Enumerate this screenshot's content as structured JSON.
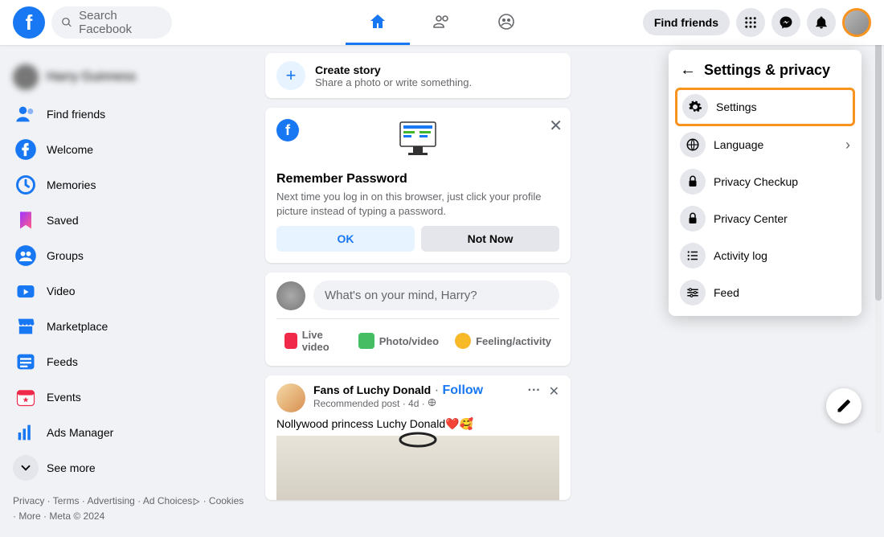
{
  "header": {
    "search_placeholder": "Search Facebook",
    "find_friends": "Find friends"
  },
  "sidebar": {
    "items": [
      {
        "label": "Find friends"
      },
      {
        "label": "Welcome"
      },
      {
        "label": "Memories"
      },
      {
        "label": "Saved"
      },
      {
        "label": "Groups"
      },
      {
        "label": "Video"
      },
      {
        "label": "Marketplace"
      },
      {
        "label": "Feeds"
      },
      {
        "label": "Events"
      },
      {
        "label": "Ads Manager"
      }
    ],
    "see_more": "See more"
  },
  "footer": {
    "privacy": "Privacy",
    "terms": "Terms",
    "advertising": "Advertising",
    "ad_choices": "Ad Choices",
    "cookies": "Cookies",
    "more": "More",
    "meta": "Meta © 2024"
  },
  "create_story": {
    "title": "Create story",
    "subtitle": "Share a photo or write something."
  },
  "remember": {
    "title": "Remember Password",
    "body": "Next time you log in on this browser, just click your profile picture instead of typing a password.",
    "ok": "OK",
    "not_now": "Not Now"
  },
  "composer": {
    "placeholder": "What's on your mind, Harry?",
    "live_video": "Live video",
    "photo_video": "Photo/video",
    "feeling": "Feeling/activity"
  },
  "post": {
    "page_name": "Fans of Luchy Donald",
    "follow": "Follow",
    "meta": "Recommended post · 4d · ",
    "text": "Nollywood princess Luchy Donald❤️🥰"
  },
  "dropdown": {
    "title": "Settings & privacy",
    "items": [
      {
        "label": "Settings",
        "highlight": true
      },
      {
        "label": "Language",
        "chevron": true
      },
      {
        "label": "Privacy Checkup"
      },
      {
        "label": "Privacy Center"
      },
      {
        "label": "Activity log"
      },
      {
        "label": "Feed"
      }
    ]
  }
}
